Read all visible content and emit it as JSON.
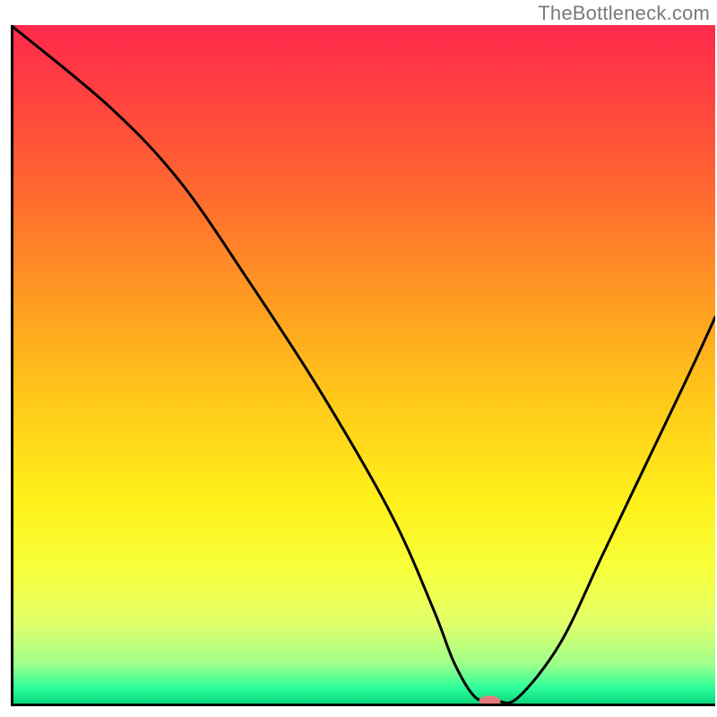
{
  "watermark": "TheBottleneck.com",
  "chart_data": {
    "type": "line",
    "title": "",
    "xlabel": "",
    "ylabel": "",
    "xlim": [
      0,
      100
    ],
    "ylim": [
      0,
      100
    ],
    "legend": false,
    "grid": false,
    "background": {
      "type": "vertical-gradient",
      "stops": [
        {
          "pos": 0.0,
          "color": "#ff2a4d"
        },
        {
          "pos": 0.1,
          "color": "#ff4040"
        },
        {
          "pos": 0.25,
          "color": "#ff6a2f"
        },
        {
          "pos": 0.4,
          "color": "#ff9a22"
        },
        {
          "pos": 0.55,
          "color": "#ffc81a"
        },
        {
          "pos": 0.7,
          "color": "#fff01a"
        },
        {
          "pos": 0.8,
          "color": "#f7ff3a"
        },
        {
          "pos": 0.88,
          "color": "#e2ff6a"
        },
        {
          "pos": 0.94,
          "color": "#9fff8a"
        },
        {
          "pos": 0.975,
          "color": "#2eff9a"
        },
        {
          "pos": 1.0,
          "color": "#08d47c"
        }
      ]
    },
    "series": [
      {
        "name": "bottleneck-curve",
        "color": "#000000",
        "stroke_width": 3,
        "x": [
          0,
          14,
          24,
          34,
          44,
          54,
          60,
          63,
          66,
          69,
          72,
          78,
          84,
          90,
          96,
          100
        ],
        "values": [
          100,
          88,
          77,
          62,
          46,
          28,
          14,
          6,
          1,
          0.5,
          1,
          9,
          22,
          35,
          48,
          57
        ]
      }
    ],
    "marker": {
      "name": "optimal-point",
      "x": 68.0,
      "y": 0.5,
      "rx": 12,
      "ry": 6,
      "color": "#e47b7b"
    },
    "border": {
      "left": {
        "visible": true,
        "color": "#000000",
        "width": 3
      },
      "bottom": {
        "visible": true,
        "color": "#000000",
        "width": 3
      },
      "right": {
        "visible": false
      },
      "top": {
        "visible": false
      }
    }
  }
}
